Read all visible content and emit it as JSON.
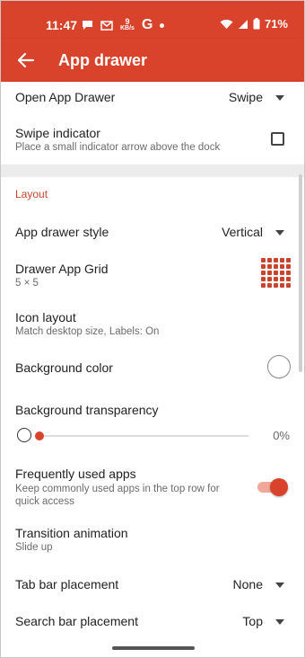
{
  "status_bar": {
    "time": "11:47",
    "speed_value": "9",
    "speed_unit": "KB/s",
    "g_letter": "G",
    "battery": "71%"
  },
  "app_bar": {
    "title": "App drawer",
    "back_icon": "arrow-back-icon"
  },
  "settings": {
    "open_app_drawer": {
      "label": "Open App Drawer",
      "value": "Swipe"
    },
    "swipe_indicator": {
      "label": "Swipe indicator",
      "subtitle": "Place a small indicator arrow above the dock",
      "checked": false
    },
    "section_layout": "Layout",
    "app_drawer_style": {
      "label": "App drawer style",
      "value": "Vertical"
    },
    "drawer_app_grid": {
      "label": "Drawer App Grid",
      "subtitle": "5 × 5"
    },
    "icon_layout": {
      "label": "Icon layout",
      "subtitle": "Match desktop size, Labels: On"
    },
    "background_color": {
      "label": "Background color",
      "color": "#ffffff"
    },
    "background_transparency": {
      "label": "Background transparency",
      "value": "0%",
      "level": 0
    },
    "frequently_used_apps": {
      "label": "Frequently used apps",
      "subtitle_line1": "Keep commonly used apps in the top row for",
      "subtitle_line2": "quick access",
      "enabled": true
    },
    "transition_animation": {
      "label": "Transition animation",
      "subtitle": "Slide up"
    },
    "tab_bar_placement": {
      "label": "Tab bar placement",
      "value": "None"
    },
    "search_bar_placement": {
      "label": "Search bar placement",
      "value": "Top"
    }
  },
  "colors": {
    "accent": "#d9422b",
    "section": "#c9442c"
  }
}
